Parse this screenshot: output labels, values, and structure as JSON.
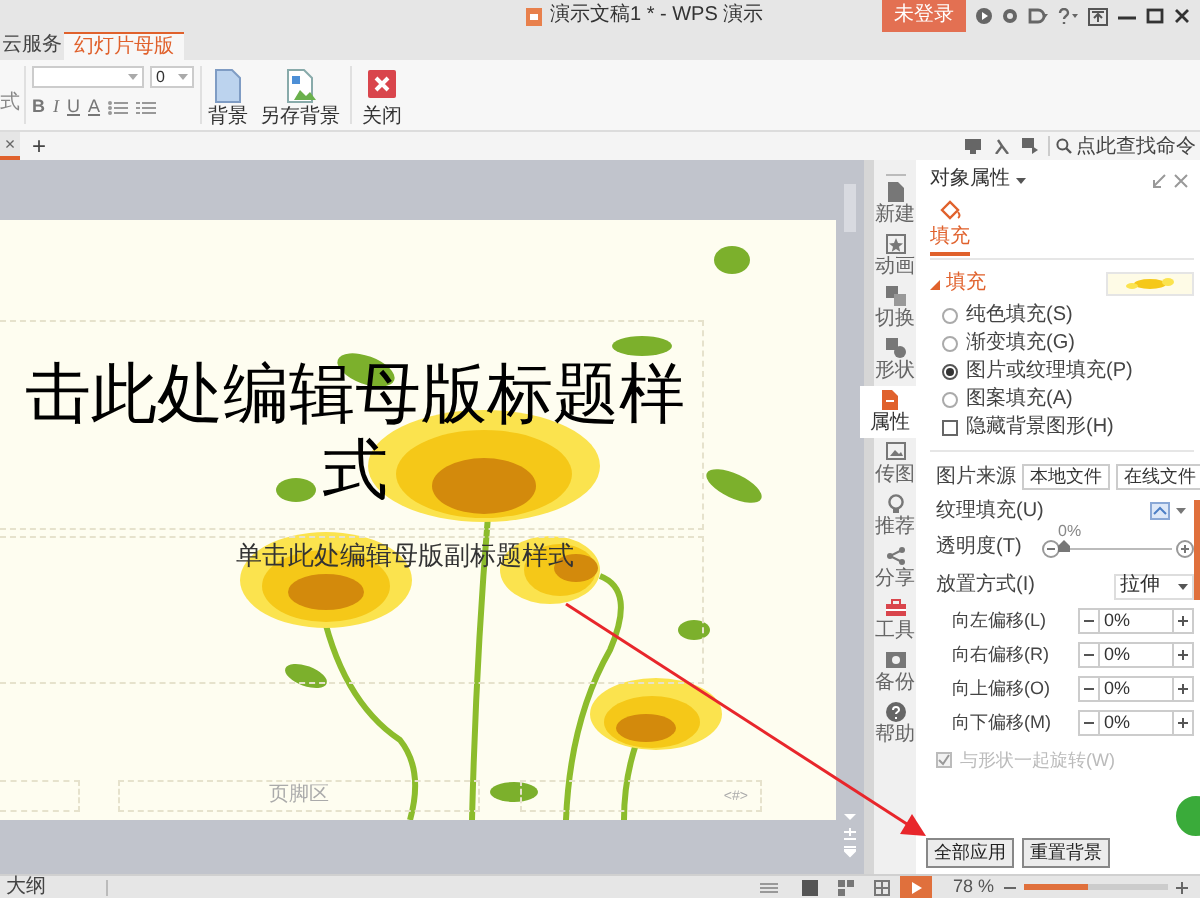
{
  "window": {
    "title": "演示文稿1 * - WPS 演示",
    "login_button": "未登录"
  },
  "menu_tabs": [
    {
      "label": "云服务",
      "selected": false
    },
    {
      "label": "幻灯片母版",
      "selected": true
    }
  ],
  "ribbon": {
    "cut_label": "式",
    "font_size": "0",
    "format_buttons": [
      "B",
      "I",
      "U",
      "A"
    ],
    "buttons": [
      {
        "label": "背景",
        "kind": "page"
      },
      {
        "label": "另存背景",
        "kind": "save"
      },
      {
        "label": "关闭",
        "kind": "close"
      }
    ]
  },
  "doc_tabs": {
    "close": "×",
    "add": "+"
  },
  "command_search": {
    "placeholder": "点此查找命令"
  },
  "slide": {
    "title": "击此处编辑母版标题样式",
    "subtitle": "单击此处编辑母版副标题样式",
    "footer": "页脚区",
    "page_number": "<#>"
  },
  "sidebar": {
    "items": [
      {
        "label": "新建",
        "selected": false
      },
      {
        "label": "动画",
        "selected": false
      },
      {
        "label": "切换",
        "selected": false
      },
      {
        "label": "形状",
        "selected": false
      },
      {
        "label": "属性",
        "selected": true
      },
      {
        "label": "传图",
        "selected": false
      },
      {
        "label": "推荐",
        "selected": false
      },
      {
        "label": "分享",
        "selected": false
      },
      {
        "label": "工具",
        "selected": false
      },
      {
        "label": "备份",
        "selected": false
      },
      {
        "label": "帮助",
        "selected": false
      }
    ]
  },
  "panel": {
    "title": "对象属性",
    "tabs": [
      {
        "label": "填充",
        "selected": true
      }
    ],
    "section": "填充",
    "fill_options": [
      {
        "label": "纯色填充(S)",
        "selected": false
      },
      {
        "label": "渐变填充(G)",
        "selected": false
      },
      {
        "label": "图片或纹理填充(P)",
        "selected": true
      },
      {
        "label": "图案填充(A)",
        "selected": false
      }
    ],
    "hide_background": {
      "label": "隐藏背景图形(H)",
      "checked": false
    },
    "picture_source": {
      "label": "图片来源",
      "buttons": [
        "本地文件",
        "在线文件"
      ]
    },
    "texture": {
      "label": "纹理填充(U)"
    },
    "transparency": {
      "label": "透明度(T)",
      "reading": "0%",
      "level": 0
    },
    "placement": {
      "label": "放置方式(I)",
      "value": "拉伸"
    },
    "offsets": [
      {
        "label": "向左偏移(L)",
        "value": "0%"
      },
      {
        "label": "向右偏移(R)",
        "value": "0%"
      },
      {
        "label": "向上偏移(O)",
        "value": "0%"
      },
      {
        "label": "向下偏移(M)",
        "value": "0%"
      }
    ],
    "rotate": {
      "label": "与形状一起旋转(W)",
      "checked": true,
      "disabled": true
    },
    "buttons": [
      "全部应用",
      "重置背景"
    ]
  },
  "status_bar": {
    "left": "大纲",
    "zoom": "78 %",
    "zoom_slider": {
      "level": 0.45
    }
  }
}
